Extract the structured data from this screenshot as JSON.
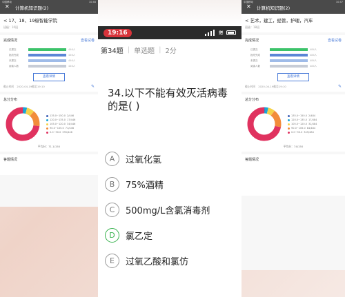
{
  "left_screen": {
    "status_left": "中国移动",
    "status_right": "10:48",
    "title": "计算机知识题(2)",
    "subtitle": "17、18、19级智能学院",
    "meta": "班级：10班",
    "completion": {
      "heading": "完成情况",
      "view_link": "查看试卷",
      "rows": [
        {
          "label": "已提交",
          "value": "446人",
          "color": "#3cc36a"
        },
        {
          "label": "批改完成",
          "value": "446人",
          "color": "#5b86d6"
        },
        {
          "label": "未提交",
          "value": "446人",
          "color": "#9fbbe8"
        },
        {
          "label": "阅读人数",
          "value": "446人",
          "color": "#c7ccd6"
        }
      ],
      "detail_button": "查看详情",
      "deadline_label": "截止时间",
      "deadline_value": "2020-04-19截至19:10"
    },
    "distribution": {
      "heading": "总分分布",
      "legend": [
        {
          "range": "135.0~150.0",
          "count": "2/446",
          "color": "#3f5fb6"
        },
        {
          "range": "120.0~135.0",
          "count": "17/446",
          "color": "#1aa7d6"
        },
        {
          "range": "105.0~120.0",
          "count": "34/446",
          "color": "#f5d24a"
        },
        {
          "range": "90.0~105.0",
          "count": "71/446",
          "color": "#f28c3a"
        },
        {
          "range": "0.0~90.0",
          "count": "335/446",
          "color": "#e0325f"
        }
      ],
      "average": "平均分：71.1/150"
    },
    "answer_heading": "答题情况"
  },
  "right_screen": {
    "status_left": "中国移动",
    "status_right": "10:47",
    "title": "计算机知识题(2)",
    "subtitle": "艺术，建工，经管，护理，汽车",
    "meta": "班级：18班",
    "completion": {
      "heading": "完成情况",
      "view_link": "查看试卷",
      "rows": [
        {
          "label": "已提交",
          "value": "484人",
          "color": "#3cc36a"
        },
        {
          "label": "批改完成",
          "value": "484人",
          "color": "#5b86d6"
        },
        {
          "label": "未提交",
          "value": "484人",
          "color": "#9fbbe8"
        },
        {
          "label": "阅读人数",
          "value": "484人",
          "color": "#c7ccd6"
        }
      ],
      "detail_button": "查看详情",
      "deadline_label": "截止时间",
      "deadline_value": "2020-04-19截至19:10"
    },
    "distribution": {
      "heading": "总分分布",
      "legend": [
        {
          "range": "135.0~150.0",
          "count": "2/484",
          "color": "#3f5fb6"
        },
        {
          "range": "120.0~135.0",
          "count": "17/484",
          "color": "#1aa7d6"
        },
        {
          "range": "105.0~120.0",
          "count": "32/484",
          "color": "#f5d24a"
        },
        {
          "range": "90.0~105.0",
          "count": "84/484",
          "color": "#f28c3a"
        },
        {
          "range": "0.0~90.0",
          "count": "349/484",
          "color": "#e0325f"
        }
      ],
      "average": "平均分：74/150"
    },
    "answer_heading": "答题情况"
  },
  "center_screen": {
    "time": "19:16",
    "question_index": "第34题",
    "question_type": "单选题",
    "question_points": "2分",
    "question_text": "34.以下不能有效灭活病毒的是(      )",
    "options": [
      {
        "letter": "A",
        "text": "过氧化氢",
        "correct": false
      },
      {
        "letter": "B",
        "text": "75%酒精",
        "correct": false
      },
      {
        "letter": "C",
        "text": "500mg/L含氯消毒剂",
        "correct": false
      },
      {
        "letter": "D",
        "text": "氯乙定",
        "correct": true
      },
      {
        "letter": "E",
        "text": "过氧乙酸和氯仿",
        "correct": false
      }
    ]
  }
}
